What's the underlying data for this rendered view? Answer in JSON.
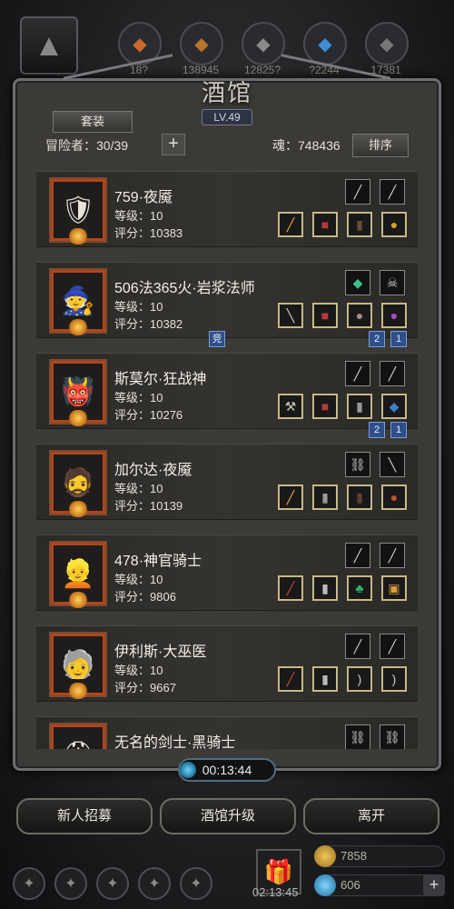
{
  "top_resources": [
    {
      "icon": "resource-1-icon",
      "value": "18?"
    },
    {
      "icon": "resource-2-icon",
      "value": "138945"
    },
    {
      "icon": "resource-3-icon",
      "value": "12825?"
    },
    {
      "icon": "resource-4-icon",
      "value": "?2244"
    },
    {
      "icon": "resource-5-icon",
      "value": "17381"
    }
  ],
  "panel": {
    "title": "酒馆",
    "level": "LV.49",
    "set_label": "套装",
    "adventurers": "冒险者：30/39",
    "soul": "魂：748436",
    "sort_label": "排序"
  },
  "heroes": [
    {
      "name": "759·夜魇",
      "level": "等级：10",
      "score": "评分：10383",
      "portrait": "dark-knight-portrait",
      "tags": []
    },
    {
      "name": "506法365火·岩浆法师",
      "level": "等级：10",
      "score": "评分：10382",
      "portrait": "hooded-mage-portrait",
      "tags": []
    },
    {
      "name": "斯莫尔·狂战神",
      "level": "等级：10",
      "score": "评分：10276",
      "portrait": "berserker-portrait",
      "tags": [
        "竞",
        "2",
        "1"
      ]
    },
    {
      "name": "加尔达·夜魇",
      "level": "等级：10",
      "score": "评分：10139",
      "portrait": "eyepatch-warrior-portrait",
      "tags": [
        "2",
        "1"
      ]
    },
    {
      "name": "478·神官骑士",
      "level": "等级：10",
      "score": "评分：9806",
      "portrait": "paladin-portrait",
      "tags": []
    },
    {
      "name": "伊利斯·大巫医",
      "level": "等级：10",
      "score": "评分：9667",
      "portrait": "witch-doctor-portrait",
      "tags": []
    },
    {
      "name": "无名的剑士·黑骑士",
      "level": "",
      "score": "",
      "portrait": "black-knight-portrait",
      "tags": []
    }
  ],
  "timer": "00:13:44",
  "buttons": {
    "recruit": "新人招募",
    "upgrade": "酒馆升级",
    "leave": "离开"
  },
  "footer": {
    "gift_timer": "02:13:45",
    "gold": "7858",
    "gems": "606"
  },
  "colors": {
    "portrait_frame": "#b0451f",
    "slot_border": "#c7b887",
    "tag_blue": "#2f4f8a"
  }
}
